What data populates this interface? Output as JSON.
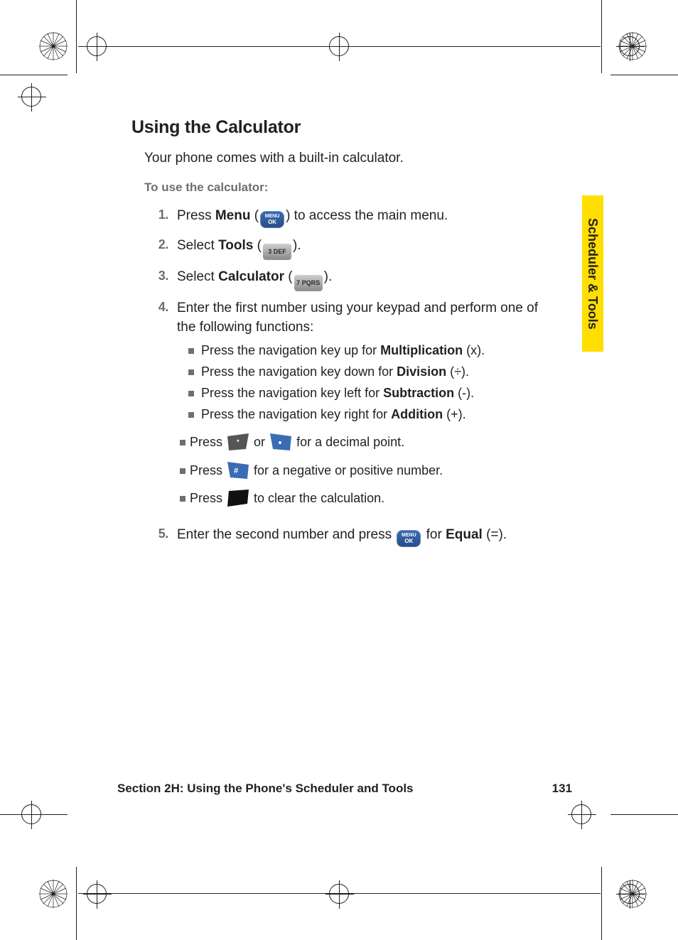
{
  "tab": {
    "label": "Scheduler & Tools"
  },
  "heading": "Using the Calculator",
  "intro": "Your phone comes with a built-in calculator.",
  "subhead": "To use the calculator:",
  "steps": [
    {
      "n": "1.",
      "pre": "Press ",
      "bold": "Menu",
      "mid": " (",
      "icon": {
        "type": "pill",
        "line1": "MENU",
        "line2": "OK"
      },
      "post": ") to access the main menu."
    },
    {
      "n": "2.",
      "pre": "Select ",
      "bold": "Tools",
      "mid": " (",
      "icon": {
        "type": "grey",
        "label": "3 DEF"
      },
      "post": ")."
    },
    {
      "n": "3.",
      "pre": "Select ",
      "bold": "Calculator",
      "mid": " (",
      "icon": {
        "type": "grey",
        "label": "7 PQRS"
      },
      "post": ")."
    },
    {
      "n": "4.",
      "text": "Enter the first number using your keypad and perform one of the following functions:",
      "sub": [
        {
          "pre": "Press the navigation key up for ",
          "bold": "Multiplication",
          "post": " (x)."
        },
        {
          "pre": "Press the navigation key down for ",
          "bold": "Division",
          "post": " (÷)."
        },
        {
          "pre": "Press the navigation key left for ",
          "bold": "Subtraction",
          "post": " (-)."
        },
        {
          "pre": "Press the navigation key right for ",
          "bold": "Addition",
          "post": " (+)."
        }
      ],
      "sub2": [
        {
          "pre": "Press ",
          "icons": [
            {
              "type": "tri",
              "fill": "#555",
              "label": "*"
            },
            {
              "plain": " or "
            },
            {
              "type": "tri",
              "fill": "#3a6cb5",
              "label": "."
            }
          ],
          "post": " for a decimal point."
        },
        {
          "pre": "Press ",
          "icons": [
            {
              "type": "tri",
              "fill": "#3a6cb5",
              "label": "#"
            }
          ],
          "post": " for a negative or positive number."
        },
        {
          "pre": "Press ",
          "icons": [
            {
              "type": "tri",
              "fill": "#111",
              "label": ""
            }
          ],
          "post": " to clear the calculation."
        }
      ]
    },
    {
      "n": "5.",
      "pre": "Enter the second number and press ",
      "icon": {
        "type": "pill",
        "line1": "MENU",
        "line2": "OK"
      },
      "mid2": " for ",
      "bold": "Equal",
      "post": " (=)."
    }
  ],
  "footer": {
    "section": "Section 2H: Using the Phone's Scheduler and Tools",
    "page": "131"
  }
}
